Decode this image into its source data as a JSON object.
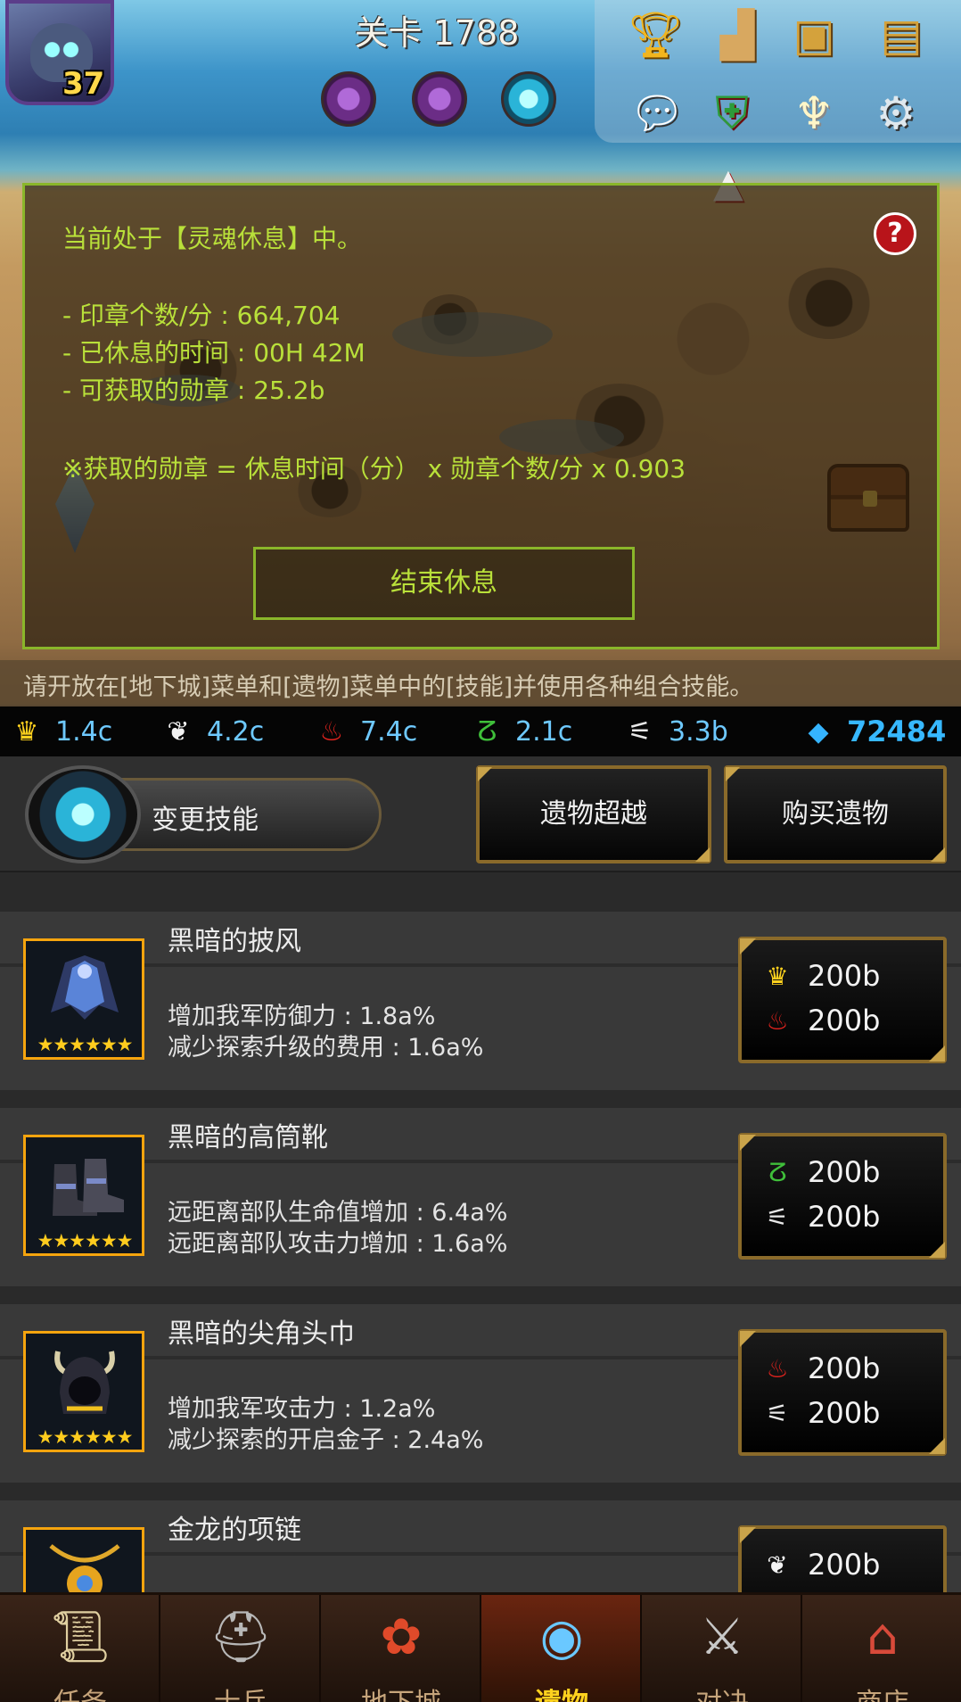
{
  "header": {
    "stage_title": "关卡 1788",
    "player_level": "37"
  },
  "top_icons": [
    "trophy-icon",
    "ranking-podium-icon",
    "hero-book-icon",
    "skill-book-icon",
    "chat-icon",
    "guild-shield-icon",
    "angel-icon",
    "settings-gear-icon"
  ],
  "rest_panel": {
    "status": "当前处于【灵魂休息】中。",
    "seals_per_min": "- 印章个数/分 : 664,704",
    "rest_time": "- 已休息的时间 : 00H 42M",
    "medals_available": "- 可获取的勋章 : 25.2b",
    "formula": "※获取的勋章 = 休息时间（分） x 勋章个数/分 x 0.903",
    "help": "?",
    "end_button": "结束休息"
  },
  "hint": "请开放在[地下城]菜单和[遗物]菜单中的[技能]并使用各种组合技能。",
  "resources": {
    "crown": "1.4c",
    "feather": "4.2c",
    "meat": "7.4c",
    "vine": "2.1c",
    "claw": "3.3b",
    "gems": "72484"
  },
  "actions": {
    "change_skill": "变更技能",
    "relic_transcend": "遗物超越",
    "buy_relic": "购买遗物"
  },
  "relics": [
    {
      "name": "黑暗的披风",
      "stars": "★★★★★★",
      "stat1": "增加我军防御力 : 1.8a%",
      "stat2": "减少探索升级的费用 : 1.6a%",
      "price1": "200b",
      "price2": "200b"
    },
    {
      "name": "黑暗的高筒靴",
      "stars": "★★★★★★",
      "stat1": "远距离部队生命值增加 : 6.4a%",
      "stat2": "远距离部队攻击力增加 : 1.6a%",
      "price1": "200b",
      "price2": "200b"
    },
    {
      "name": "黑暗的尖角头巾",
      "stars": "★★★★★★",
      "stat1": "增加我军攻击力 : 1.2a%",
      "stat2": "减少探索的开启金子 : 2.4a%",
      "price1": "200b",
      "price2": "200b"
    },
    {
      "name": "金龙的项链",
      "price1": "200b"
    }
  ],
  "nav": {
    "quest": "任务",
    "soldier": "士兵",
    "dungeon": "地下城",
    "relic": "遗物",
    "battle": "对决",
    "shop": "商店"
  }
}
